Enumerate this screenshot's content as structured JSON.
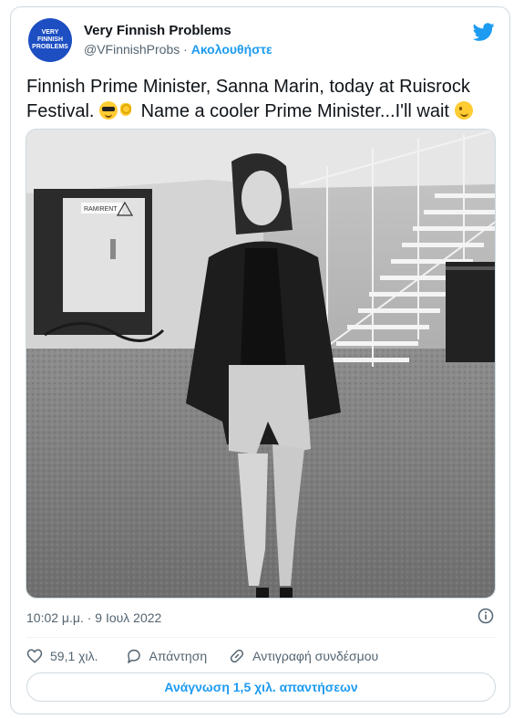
{
  "account": {
    "avatar_lines": [
      "VERY",
      "FINNISH",
      "PROBLEMS"
    ],
    "name": "Very Finnish Problems",
    "handle": "@VFinnishProbs",
    "separator": " · ",
    "follow_label": "Ακολουθήστε"
  },
  "tweet": {
    "text_part1": "Finnish Prime Minister, Sanna Marin, today at Ruisrock Festival. ",
    "text_part2": " Name a cooler Prime Minister...I'll wait ",
    "emojis": [
      "smiling-face-with-sunglasses",
      "ok-hand",
      "winking-face"
    ],
    "timestamp": "10:02 μ.μ. · 9 Ιουλ 2022"
  },
  "actions": {
    "likes": "59,1 χιλ.",
    "reply_label": "Απάντηση",
    "copy_link_label": "Αντιγραφή συνδέσμου",
    "read_replies_label": "Ανάγνωση 1,5 χιλ. απαντήσεων"
  },
  "photo": {
    "sign_text": "RAMIRENT",
    "tone": "black-and-white"
  },
  "colors": {
    "accent": "#1d9bf0",
    "avatar_bg": "#1d4ec2",
    "muted_text": "#536471",
    "border": "#cfd9de"
  }
}
